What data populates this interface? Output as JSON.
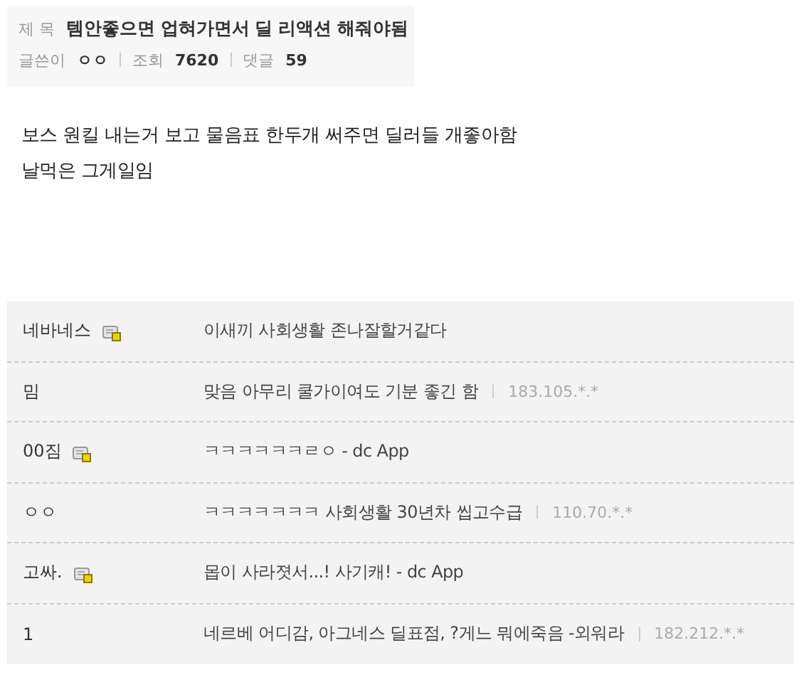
{
  "post": {
    "title_label": "제 목",
    "title": "템안좋으면 업혀가면서 딜 리액션 해줘야됨",
    "author_label": "글쓴이",
    "author": "ㅇㅇ",
    "views_label": "조회",
    "views": "7620",
    "comments_label": "댓글",
    "comments": "59"
  },
  "body": [
    "보스 원킬 내는거 보고 물음표 한두개 써주면 딜러들 개좋아함",
    "날먹은 그게일임"
  ],
  "comments": [
    {
      "name": "네바네스",
      "member": true,
      "text": "이새끼 사회생활 존나잘할거같다"
    },
    {
      "name": "밈",
      "member": false,
      "text": "맞음 아무리 쿨가이여도 기분 좋긴 함",
      "ip": "183.105.*.*"
    },
    {
      "name": "00짐",
      "member": true,
      "text": "ㅋㅋㅋㅋㅋㅋㄹㅇ - dc App"
    },
    {
      "name": "ㅇㅇ",
      "member": false,
      "text": "ㅋㅋㅋㅋㅋㅋㅋ 사회생활 30년차 씹고수급",
      "ip": "110.70.*.*"
    },
    {
      "name": "고싸.",
      "member": true,
      "text": "몹이 사라졋서...! 사기캐! - dc App"
    },
    {
      "name": "1",
      "member": false,
      "text": "네르베 어디감, 아그네스 딜표점, ?게느 뭐에죽음 -외워라",
      "ip": "182.212.*.*"
    }
  ]
}
